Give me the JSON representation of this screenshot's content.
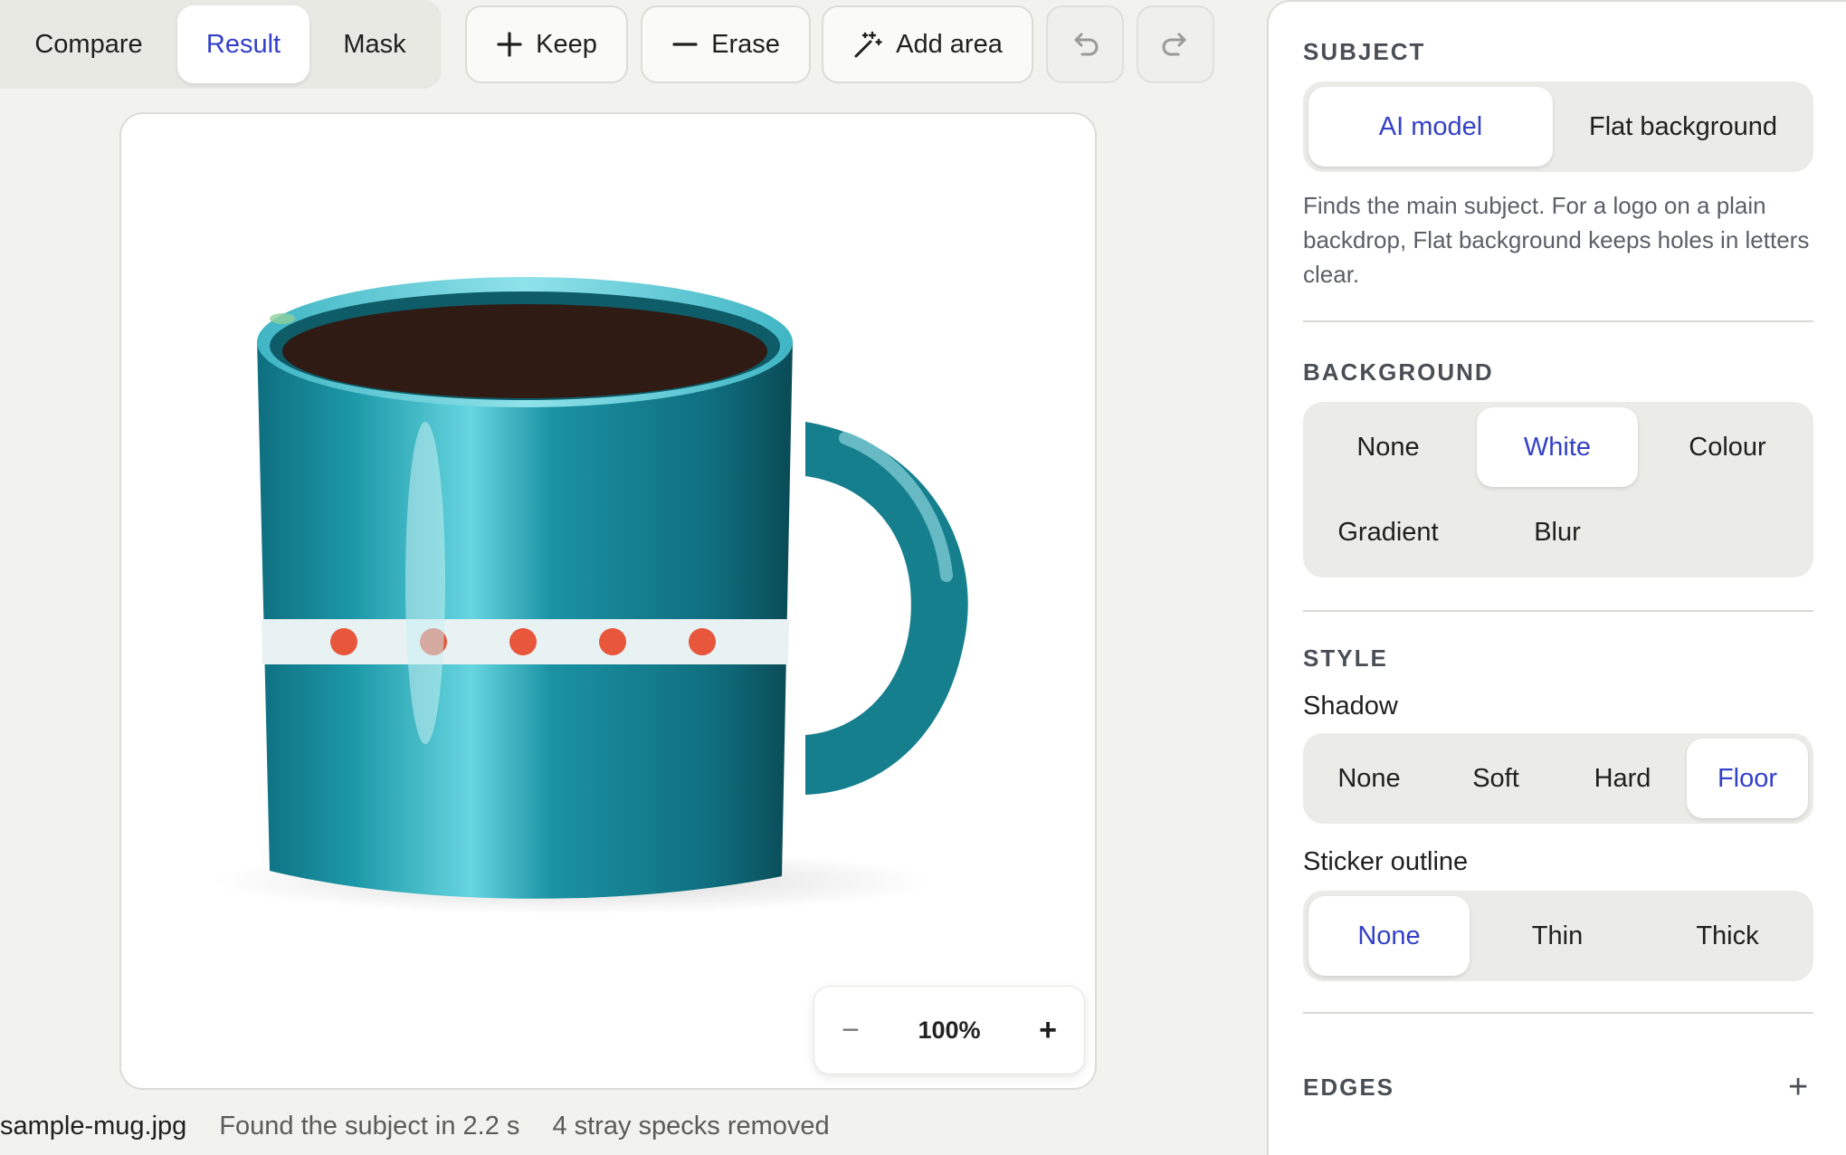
{
  "toolbar": {
    "view_modes": [
      "Compare",
      "Result",
      "Mask"
    ],
    "active_view": "Result",
    "keep_label": "Keep",
    "erase_label": "Erase",
    "add_area_label": "Add area",
    "undo_icon": "undo-icon",
    "redo_icon": "redo-icon"
  },
  "canvas": {
    "zoom_level": "100%",
    "zoom_out_symbol": "−",
    "zoom_in_symbol": "+"
  },
  "status": {
    "file_name": "sample-mug.jpg",
    "detect_message": "Found the subject in 2.2 s",
    "cleanup_message": "4 stray specks removed"
  },
  "panel": {
    "subject": {
      "title": "SUBJECT",
      "options": [
        "AI model",
        "Flat background"
      ],
      "selected": "AI model",
      "description": "Finds the main subject. For a logo on a plain backdrop, Flat background keeps holes in letters clear."
    },
    "background": {
      "title": "BACKGROUND",
      "options": [
        "None",
        "White",
        "Colour",
        "Gradient",
        "Blur"
      ],
      "selected": "White"
    },
    "style": {
      "title": "STYLE",
      "shadow_label": "Shadow",
      "shadow_options": [
        "None",
        "Soft",
        "Hard",
        "Floor"
      ],
      "shadow_selected": "Floor",
      "outline_label": "Sticker outline",
      "outline_options": [
        "None",
        "Thin",
        "Thick"
      ],
      "outline_selected": "None"
    },
    "edges": {
      "title": "EDGES",
      "expand_symbol": "+"
    }
  },
  "colors": {
    "accent": "#3340c8",
    "mug_teal": "#1a8c9c",
    "mug_dots": "#e8563c",
    "coffee": "#2f1b14"
  }
}
